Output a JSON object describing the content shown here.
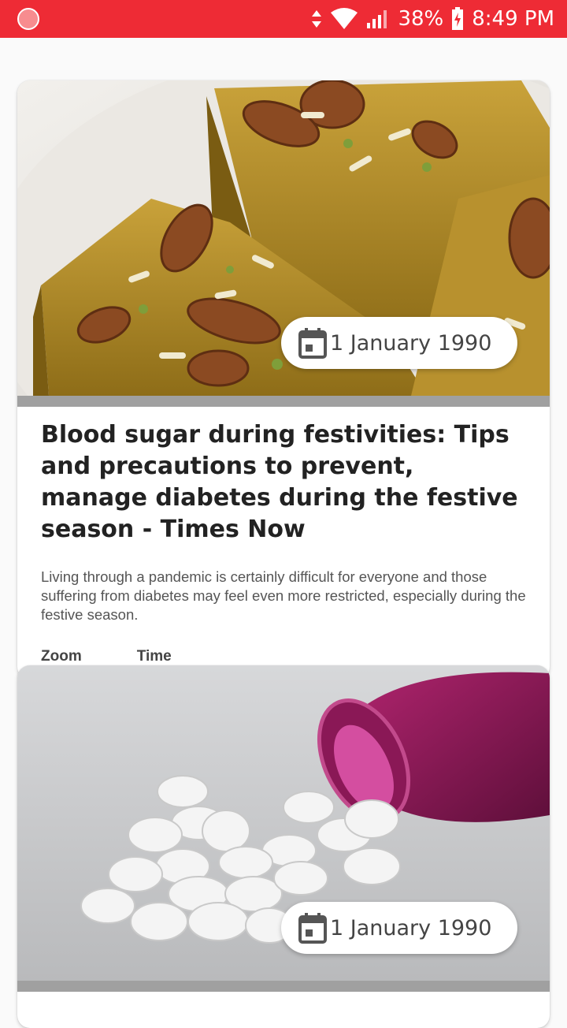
{
  "status_bar": {
    "battery": "38%",
    "time": "8:49 PM",
    "icons": [
      "app-notification-icon",
      "data-arrows-icon",
      "wifi-icon",
      "signal-icon",
      "battery-charging-icon"
    ],
    "background": "#ee2b35"
  },
  "articles": [
    {
      "image": "sweet-almond-barfi-photo",
      "date": "1 January 1990",
      "title": "Blood sugar during festivities: Tips and precautions to prevent, manage diabetes during the festive season - Times Now",
      "description": "Living through a pandemic is certainly difficult for everyone and those suffering from diabetes may feel even more restricted, especially during the festive season.",
      "source": "Zoom",
      "category": "Time"
    },
    {
      "image": "pills-spilling-from-bottle-photo",
      "date": "1 January 1990",
      "title": "",
      "description": "",
      "source": "",
      "category": ""
    }
  ]
}
